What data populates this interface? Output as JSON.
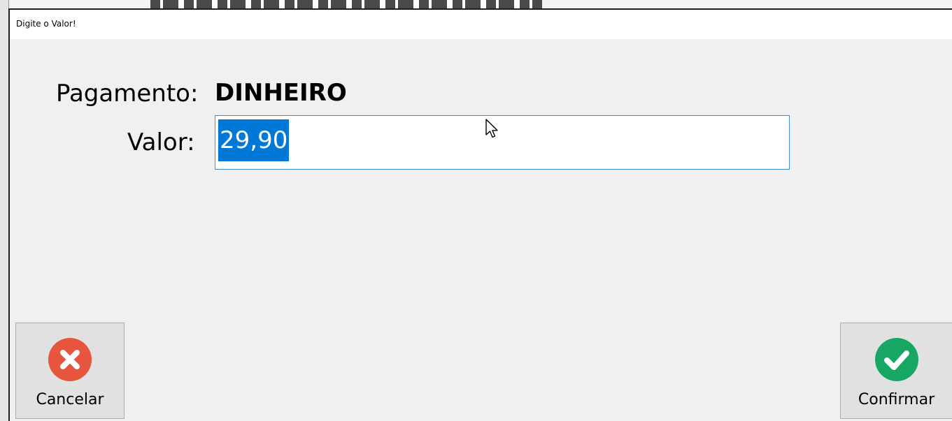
{
  "dialog": {
    "title": "Digite o Valor!"
  },
  "form": {
    "payment_label": "Pagamento:",
    "payment_method": "DINHEIRO",
    "amount_label": "Valor:",
    "amount_value": "29,90"
  },
  "buttons": {
    "cancel": {
      "label": "Cancelar",
      "icon": "close-circle-icon",
      "color": "#e8553e"
    },
    "confirm": {
      "label": "Confirmar",
      "icon": "check-circle-icon",
      "color": "#16a765"
    }
  },
  "colors": {
    "selection": "#0078d7",
    "input_border": "#3d8fd8",
    "dialog_bg": "#f0f0f0"
  }
}
